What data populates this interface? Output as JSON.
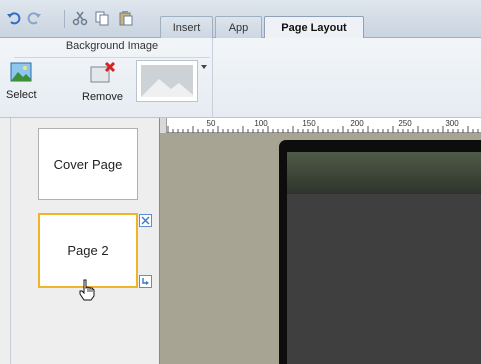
{
  "quick_access": {
    "icons": [
      "undo-icon",
      "redo-icon",
      "cut-icon",
      "copy-icon",
      "paste-icon"
    ]
  },
  "tabs": [
    {
      "label": "Insert",
      "active": false
    },
    {
      "label": "App",
      "active": false
    },
    {
      "label": "Page Layout",
      "active": true
    }
  ],
  "ribbon": {
    "group_title": "Background Image",
    "buttons": {
      "select": "Select",
      "remove": "Remove"
    }
  },
  "pages": [
    {
      "label": "Cover Page",
      "selected": false
    },
    {
      "label": "Page 2",
      "selected": true
    }
  ],
  "ruler": {
    "ticks": [
      "50",
      "100",
      "150",
      "200",
      "250",
      "300"
    ]
  },
  "colors": {
    "selection_border": "#f0b428",
    "workspace_bg": "#a8a493",
    "device_frame": "#0d0d0d",
    "screen": "#3f3f3f",
    "accent_blue": "#5b8fd1"
  }
}
